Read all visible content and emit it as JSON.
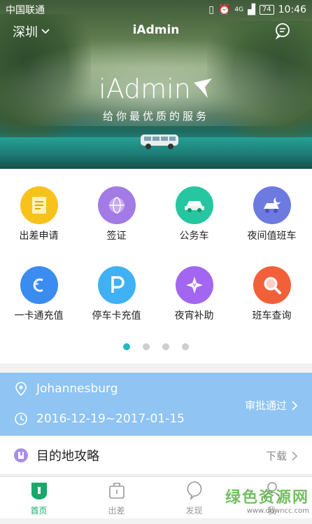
{
  "status_bar": {
    "carrier": "中国联通",
    "network": "4G",
    "battery": "74",
    "time": "10:46"
  },
  "header": {
    "city": "深圳",
    "title": "iAdmin"
  },
  "hero": {
    "logo": "iAdmin",
    "tagline": "给你最优质的服务"
  },
  "grid": {
    "items": [
      {
        "label": "出差申请",
        "icon": "document-icon",
        "color": "#f7c31b"
      },
      {
        "label": "签证",
        "icon": "globe-icon",
        "color": "#a37be6"
      },
      {
        "label": "公务车",
        "icon": "car-icon",
        "color": "#25c6a0"
      },
      {
        "label": "夜间值班车",
        "icon": "night-car-icon",
        "color": "#6d7ae0"
      },
      {
        "label": "一卡通充值",
        "icon": "card-icon",
        "color": "#3a8cf0"
      },
      {
        "label": "停车卡充值",
        "icon": "parking-icon",
        "color": "#3fb1f4"
      },
      {
        "label": "夜宵补助",
        "icon": "sparkle-yen-icon",
        "color": "#a366f0"
      },
      {
        "label": "班车查询",
        "icon": "search-icon",
        "color": "#f2603a"
      }
    ],
    "page_count": 4,
    "active_page": 1
  },
  "trip": {
    "destination": "Johannesburg",
    "dates": "2016-12-19~2017-01-15",
    "status": "审批通过"
  },
  "guide": {
    "title": "目的地攻略",
    "action": "下载"
  },
  "tabbar": {
    "tabs": [
      {
        "label": "首页",
        "icon": "home-icon",
        "active": true
      },
      {
        "label": "出差",
        "icon": "suitcase-icon",
        "active": false
      },
      {
        "label": "发现",
        "icon": "discover-icon",
        "active": false
      },
      {
        "label": "我",
        "icon": "person-icon",
        "active": false
      }
    ]
  },
  "watermark": {
    "name": "绿色资源网",
    "url": "www.downcc.com"
  },
  "colors": {
    "accent": "#1aa86a",
    "trip_bg": "#8fc4f3",
    "dot_active": "#2bb7c2"
  }
}
